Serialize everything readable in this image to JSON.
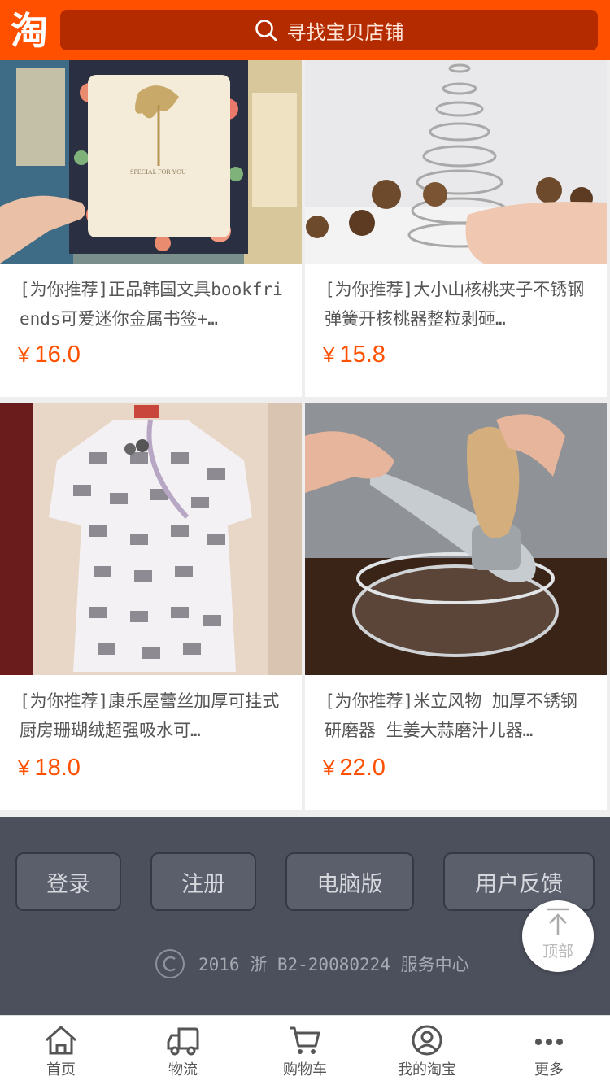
{
  "header": {
    "logo_text": "淘",
    "search_placeholder": "寻找宝贝店铺"
  },
  "products": [
    {
      "title": "[为你推荐]正品韩国文具bookfriends可爱迷你金属书签+…",
      "currency": "¥",
      "price": "16.0"
    },
    {
      "title": "[为你推荐]大小山核桃夹子不锈钢弹簧开核桃器整粒剥砸…",
      "currency": "¥",
      "price": "15.8"
    },
    {
      "title": "[为你推荐]康乐屋蕾丝加厚可挂式厨房珊瑚绒超强吸水可…",
      "currency": "¥",
      "price": "18.0"
    },
    {
      "title": "[为你推荐]米立风物 加厚不锈钢研磨器 生姜大蒜磨汁儿器…",
      "currency": "¥",
      "price": "22.0"
    }
  ],
  "footer": {
    "buttons": [
      "登录",
      "注册",
      "电脑版",
      "用户反馈"
    ],
    "copyright": "2016 浙 B2-20080224 服务中心",
    "to_top": "顶部"
  },
  "tabbar": {
    "items": [
      {
        "label": "首页",
        "icon": "home-icon"
      },
      {
        "label": "物流",
        "icon": "truck-icon"
      },
      {
        "label": "购物车",
        "icon": "cart-icon"
      },
      {
        "label": "我的淘宝",
        "icon": "user-icon"
      },
      {
        "label": "更多",
        "icon": "more-icon"
      }
    ]
  },
  "colors": {
    "brand": "#ff5000",
    "search_bg": "#b52b00",
    "footer_bg": "#4c505c"
  }
}
